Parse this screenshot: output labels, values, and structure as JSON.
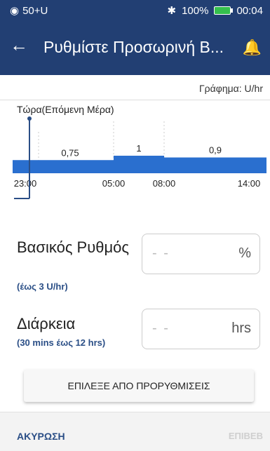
{
  "status_bar": {
    "carrier": "50+U",
    "bluetooth_icon": "bluetooth-icon",
    "battery": "100%",
    "time": "00:04"
  },
  "app_bar": {
    "title": "Ρυθμίστε Προσωρινή Β...",
    "back_icon": "arrow-left-icon",
    "bell_icon": "bell-icon"
  },
  "graph": {
    "units_label": "Γράφημα: U/hr",
    "now_label": "Τώρα(Επόμενη Μέρα)"
  },
  "chart_data": {
    "type": "area",
    "x_ticks": [
      "23:00",
      "05:00",
      "08:00",
      "14:00"
    ],
    "segments": [
      {
        "from": "23:00",
        "to": "05:00",
        "value": 0.75,
        "label": "0,75"
      },
      {
        "from": "05:00",
        "to": "08:00",
        "value": 1,
        "label": "1"
      },
      {
        "from": "08:00",
        "to": "14:00",
        "value": 0.9,
        "label": "0,9"
      }
    ],
    "color": "#2a6fcf"
  },
  "basal_rate": {
    "label": "Βασικός Ρυθμός",
    "sub": "(έως 3 U/hr)",
    "value": "- -",
    "unit": "%"
  },
  "duration": {
    "label": "Διάρκεια",
    "sub": "(30 mins έως 12 hrs)",
    "value": "- -",
    "unit": "hrs"
  },
  "preset_button": "ΕΠΙΛΕΞΕ ΑΠΟ ΠΡΟΡΥΘΜΙΣΕΙΣ",
  "footer": {
    "cancel": "ΑΚΥΡΩΣΗ",
    "next": "ΕΠΙΒΕΒ"
  }
}
